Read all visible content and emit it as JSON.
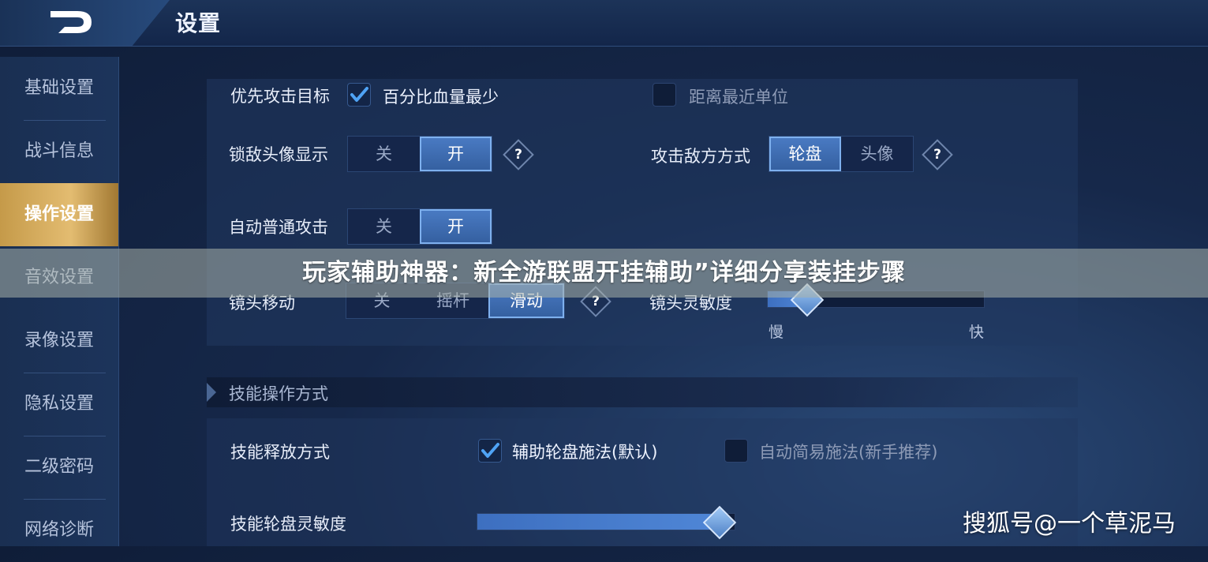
{
  "header": {
    "title": "设置",
    "back_icon": "back-arrow-icon"
  },
  "sidebar": {
    "items": [
      {
        "label": "基础设置",
        "active": false
      },
      {
        "label": "战斗信息",
        "active": false
      },
      {
        "label": "操作设置",
        "active": true
      },
      {
        "label": "音效设置",
        "active": false
      },
      {
        "label": "录像设置",
        "active": false
      },
      {
        "label": "隐私设置",
        "active": false
      },
      {
        "label": "二级密码",
        "active": false
      },
      {
        "label": "网络诊断",
        "active": false
      }
    ]
  },
  "settings": {
    "priority_target": {
      "label": "优先攻击目标",
      "option1": {
        "label": "百分比血量最少",
        "checked": true
      },
      "option2": {
        "label": "距离最近单位",
        "checked": false
      }
    },
    "lock_avatar": {
      "label": "锁敌头像显示",
      "off": "关",
      "on": "开",
      "selected": "开"
    },
    "attack_mode": {
      "label": "攻击敌方方式",
      "opt1": "轮盘",
      "opt2": "头像",
      "selected": "轮盘"
    },
    "auto_attack": {
      "label": "自动普通攻击",
      "off": "关",
      "on": "开",
      "selected": "开"
    },
    "camera_move": {
      "label": "镜头移动",
      "opt1": "关",
      "opt2": "摇杆",
      "opt3": "滑动",
      "selected": "滑动"
    },
    "camera_sensitivity": {
      "label": "镜头灵敏度",
      "min_label": "慢",
      "max_label": "快",
      "value": 0.18
    },
    "help_symbol": "?"
  },
  "banner": {
    "text": "玩家辅助神器：新全游联盟开挂辅助”详细分享装挂步骤"
  },
  "skill_section": {
    "title": "技能操作方式",
    "release_mode": {
      "label": "技能释放方式",
      "option1": {
        "label": "辅助轮盘施法(默认)",
        "checked": true
      },
      "option2": {
        "label": "自动简易施法(新手推荐)",
        "checked": false
      }
    },
    "wheel_sensitivity": {
      "label": "技能轮盘灵敏度",
      "value": 0.94
    }
  },
  "watermark": {
    "text": "搜狐号@一个草泥马"
  },
  "colors": {
    "accent": "#4a7bc4",
    "active_tab": "#e3bc71",
    "background": "#16284a"
  }
}
